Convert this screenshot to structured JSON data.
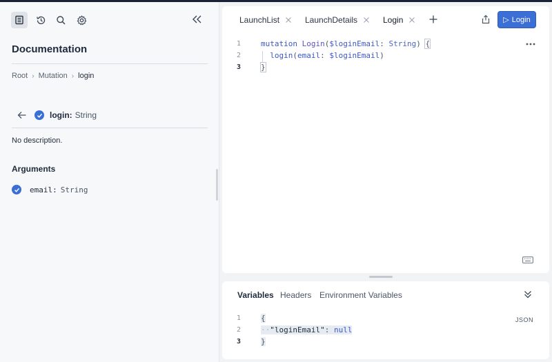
{
  "sidebar": {
    "title": "Documentation",
    "breadcrumb": [
      "Root",
      "Mutation",
      "login"
    ],
    "breadcrumb_sep": "›",
    "field": {
      "name": "login:",
      "type": "String"
    },
    "description": "No description.",
    "arguments_title": "Arguments",
    "arguments": [
      {
        "name": "email:",
        "type": "String"
      }
    ]
  },
  "tabs": [
    {
      "label": "LaunchList"
    },
    {
      "label": "LaunchDetails"
    },
    {
      "label": "Login"
    }
  ],
  "run_button": {
    "icon": "▷",
    "label": "Login"
  },
  "editor": {
    "line_numbers": [
      "1",
      "2",
      "3"
    ],
    "line1": {
      "kw": "mutation",
      "name": "Login",
      "open_paren": "(",
      "var": "$loginEmail",
      "colon": ":",
      "type": "String",
      "close_paren": ")",
      "brace": "{"
    },
    "line2": {
      "field": "login",
      "open_paren": "(",
      "arg": "email",
      "colon": ":",
      "var": "$loginEmail",
      "close_paren": ")"
    },
    "line3": {
      "brace": "}"
    }
  },
  "variables": {
    "tabs": [
      "Variables",
      "Headers",
      "Environment Variables"
    ],
    "format_label": "JSON",
    "line_numbers": [
      "1",
      "2",
      "3"
    ],
    "open_brace": "{",
    "indent_dots": "··",
    "key": "\"loginEmail\"",
    "colon": ":",
    "value": "null",
    "close_brace": "}"
  },
  "colors": {
    "accent": "#3b6fd6",
    "panel": "#f7f8fa",
    "background": "#f2f3f5"
  },
  "icons": [
    "docs-icon",
    "history-icon",
    "search-icon",
    "gear-icon",
    "collapse-icon",
    "back-arrow-icon",
    "check-icon",
    "close-icon",
    "plus-icon",
    "share-icon",
    "more-icon",
    "keyboard-icon",
    "chevron-double-down-icon"
  ]
}
